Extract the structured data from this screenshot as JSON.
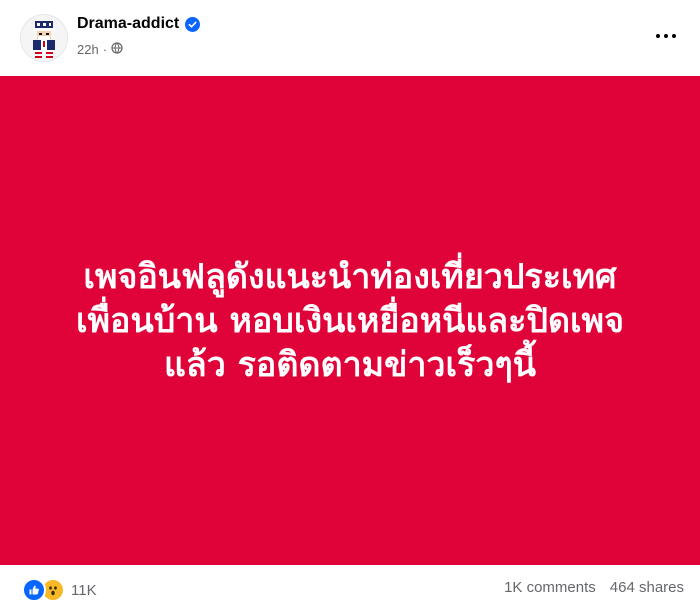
{
  "post": {
    "author": "Drama-addict",
    "timestamp": "22h",
    "audience_icon": "globe-icon",
    "verified_icon": "verified-badge-icon",
    "menu_icon": "more-options-icon",
    "card": {
      "background": "#e0033a",
      "lines": [
        "เพจอินฟลูดังแนะนำท่องเที่ยวประเทศ",
        "เพื่อนบ้าน หอบเงินเหยื่อหนีและปิดเพจ",
        "แล้ว รอติดตามข่าวเร็วๆนี้"
      ]
    },
    "footer": {
      "reactions": [
        "like",
        "wow"
      ],
      "reaction_count": "11K",
      "comments": "1K comments",
      "shares": "464 shares"
    }
  }
}
